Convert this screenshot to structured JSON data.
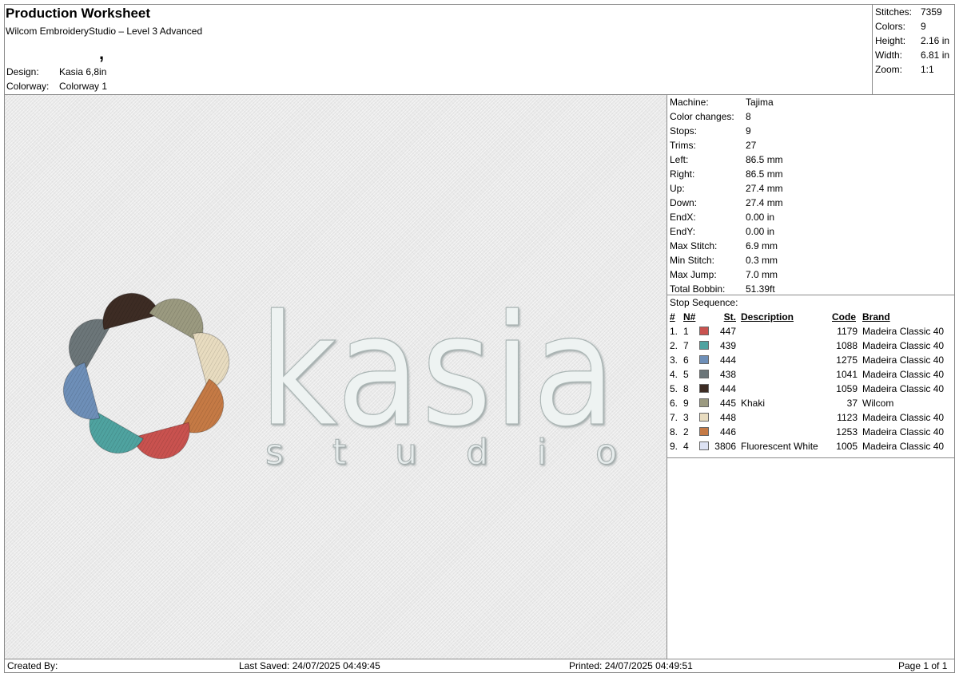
{
  "header": {
    "title": "Production Worksheet",
    "subtitle": "Wilcom EmbroideryStudio – Level 3 Advanced",
    "apostrophe": ",",
    "design_label": "Design:",
    "design_value": "Kasia 6,8in",
    "colorway_label": "Colorway:",
    "colorway_value": "Colorway 1"
  },
  "summary": [
    {
      "label": "Stitches:",
      "value": "7359"
    },
    {
      "label": "Colors:",
      "value": "9"
    },
    {
      "label": "Height:",
      "value": "2.16 in"
    },
    {
      "label": "Width:",
      "value": "6.81 in"
    },
    {
      "label": "Zoom:",
      "value": "1:1"
    }
  ],
  "details": [
    {
      "label": "Machine:",
      "value": "Tajima"
    },
    {
      "label": "Color changes:",
      "value": "8"
    },
    {
      "label": "Stops:",
      "value": "9"
    },
    {
      "label": "Trims:",
      "value": "27"
    },
    {
      "label": "Left:",
      "value": "86.5 mm"
    },
    {
      "label": "Right:",
      "value": "86.5 mm"
    },
    {
      "label": "Up:",
      "value": "27.4 mm"
    },
    {
      "label": "Down:",
      "value": "27.4 mm"
    },
    {
      "label": "EndX:",
      "value": "0.00 in"
    },
    {
      "label": "EndY:",
      "value": "0.00 in"
    },
    {
      "label": "Max Stitch:",
      "value": "6.9 mm"
    },
    {
      "label": "Min Stitch:",
      "value": "0.3 mm"
    },
    {
      "label": "Max Jump:",
      "value": "7.0 mm"
    },
    {
      "label": "Total Bobbin:",
      "value": "51.39ft"
    }
  ],
  "stops": {
    "title": "Stop Sequence:",
    "headers": {
      "num": "#",
      "n": "N#",
      "st": "St.",
      "desc": "Description",
      "code": "Code",
      "brand": "Brand"
    },
    "rows": [
      {
        "num": "1.",
        "n": "1",
        "color": "#c9524f",
        "st": "447",
        "desc": "",
        "code": "1179",
        "brand": "Madeira Classic 40"
      },
      {
        "num": "2.",
        "n": "7",
        "color": "#4fa3a0",
        "st": "439",
        "desc": "",
        "code": "1088",
        "brand": "Madeira Classic 40"
      },
      {
        "num": "3.",
        "n": "6",
        "color": "#6e8fb8",
        "st": "444",
        "desc": "",
        "code": "1275",
        "brand": "Madeira Classic 40"
      },
      {
        "num": "4.",
        "n": "5",
        "color": "#6c7679",
        "st": "438",
        "desc": "",
        "code": "1041",
        "brand": "Madeira Classic 40"
      },
      {
        "num": "5.",
        "n": "8",
        "color": "#3d2c24",
        "st": "444",
        "desc": "",
        "code": "1059",
        "brand": "Madeira Classic 40"
      },
      {
        "num": "6.",
        "n": "9",
        "color": "#9b9a80",
        "st": "445",
        "desc": "Khaki",
        "code": "37",
        "brand": "Wilcom"
      },
      {
        "num": "7.",
        "n": "3",
        "color": "#e8dcc0",
        "st": "448",
        "desc": "",
        "code": "1123",
        "brand": "Madeira Classic 40"
      },
      {
        "num": "8.",
        "n": "2",
        "color": "#c57a45",
        "st": "446",
        "desc": "",
        "code": "1253",
        "brand": "Madeira Classic 40"
      },
      {
        "num": "9.",
        "n": "4",
        "color": "#dde2f4",
        "st": "3806",
        "desc": "Fluorescent White",
        "code": "1005",
        "brand": "Madeira Classic 40"
      }
    ]
  },
  "footer": {
    "created_by": "Created By:",
    "last_saved": "Last Saved: 24/07/2025 04:49:45",
    "printed": "Printed: 24/07/2025 04:49:51",
    "page": "Page 1 of 1"
  },
  "preview": {
    "logo_word": "kasia",
    "logo_sub": "studio",
    "petal_colors": [
      "#6c7679",
      "#3d2c24",
      "#9b9a80",
      "#e8dcc0",
      "#c57a45",
      "#c9524f",
      "#4fa3a0",
      "#6e8fb8"
    ],
    "thread_white": "#eef3f2"
  }
}
